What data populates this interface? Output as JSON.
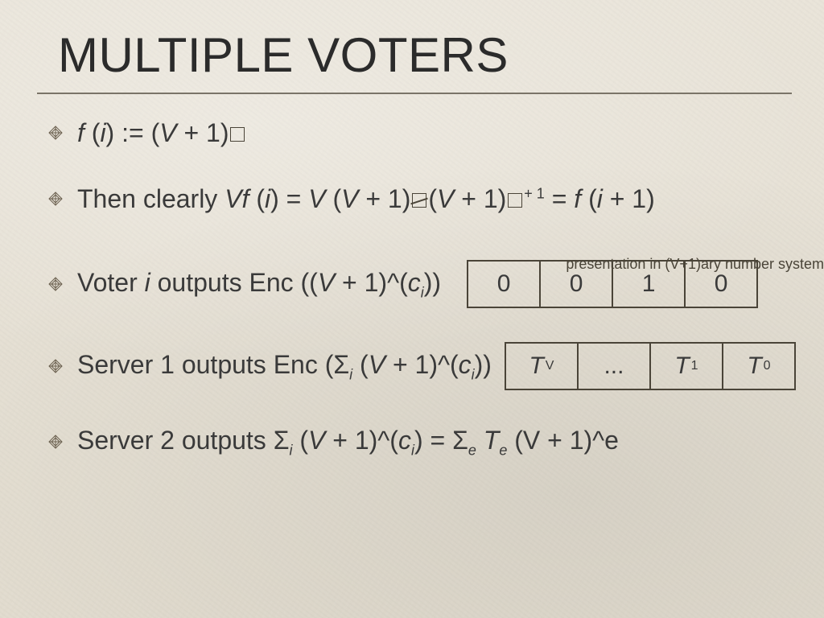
{
  "title": "MULTIPLE VOTERS",
  "bullets": {
    "b1": {
      "pre": "f (i) := (V + 1)"
    },
    "b2": {
      "pre": "Then clearly ",
      "mid": "Vf (i) = V (V + 1)",
      "lt": "< (V + 1)",
      "plus": "⁺ ¹",
      "eq": "= f (i + 1)"
    },
    "caption": "presentation in (V+1)ary number system",
    "b3": {
      "pre": "Voter ",
      "ivar": "i",
      "post": " outputs Enc ((",
      "vp1": "V + 1)^(c",
      "ci": "i",
      "close": "))"
    },
    "b4": {
      "pre": "Server 1 outputs Enc (Σ",
      "si": "i",
      "vp1": " (V + 1)^(c",
      "ci": "i",
      "close": "))"
    },
    "b5": {
      "pre": "Server 2 outputs Σ",
      "si": "i",
      "mid": " (V + 1)^(c",
      "ci": "i",
      "eq": ") = Σ",
      "se": "e",
      "te": " T",
      "tee": "e",
      "tail": " (V + 1)^e"
    }
  },
  "cells_top": [
    "0",
    "0",
    "1",
    "0"
  ],
  "cells_bot": {
    "c0": {
      "t": "T",
      "s": "V"
    },
    "c1": "...",
    "c2": {
      "t": "T",
      "s": "1"
    },
    "c3": {
      "t": "T",
      "s": "0"
    }
  }
}
